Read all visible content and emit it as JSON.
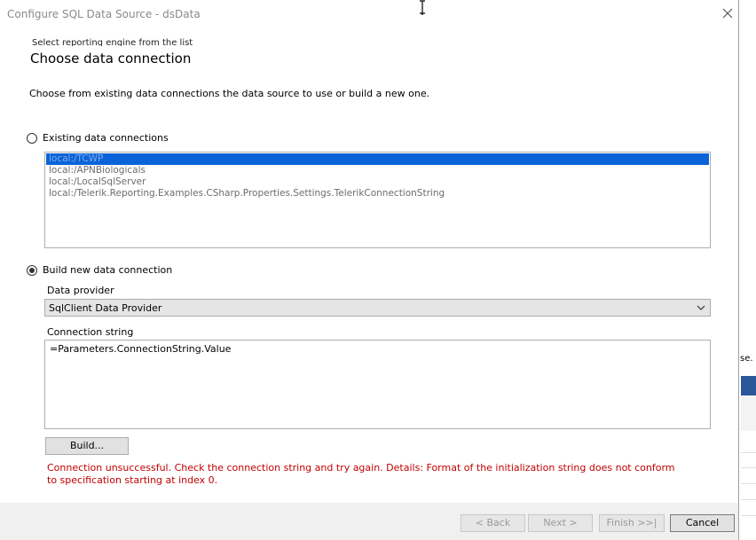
{
  "window": {
    "title": "Configure SQL Data Source - dsData"
  },
  "wizard": {
    "breadcrumb": "Select reporting engine from the list",
    "heading": "Choose data connection",
    "description": "Choose from existing data connections the data source to use or build a new one."
  },
  "existing": {
    "label": "Existing data connections",
    "selected": false,
    "items": [
      {
        "label": "local:/TCWP",
        "selected": true
      },
      {
        "label": "local:/APNBiologicals",
        "selected": false
      },
      {
        "label": "local:/LocalSqlServer",
        "selected": false
      },
      {
        "label": "local:/Telerik.Reporting.Examples.CSharp.Properties.Settings.TelerikConnectionString",
        "selected": false
      }
    ]
  },
  "build_new": {
    "label": "Build new data connection",
    "selected": true,
    "data_provider_label": "Data provider",
    "data_provider_value": "SqlClient Data Provider",
    "connection_string_label": "Connection string",
    "connection_string_value": "=Parameters.ConnectionString.Value",
    "build_button": "Build...",
    "error": "Connection unsuccessful. Check the connection string and try again. Details: Format of the initialization string does not conform to specification starting at index 0."
  },
  "footer": {
    "back": "< Back",
    "next": "Next >",
    "finish": "Finish >>|",
    "cancel": "Cancel"
  },
  "background_app": {
    "text_fragment": "se."
  },
  "colors": {
    "error": "#c00000",
    "selection": "#0a64d8",
    "background_accent": "#2b579a"
  }
}
